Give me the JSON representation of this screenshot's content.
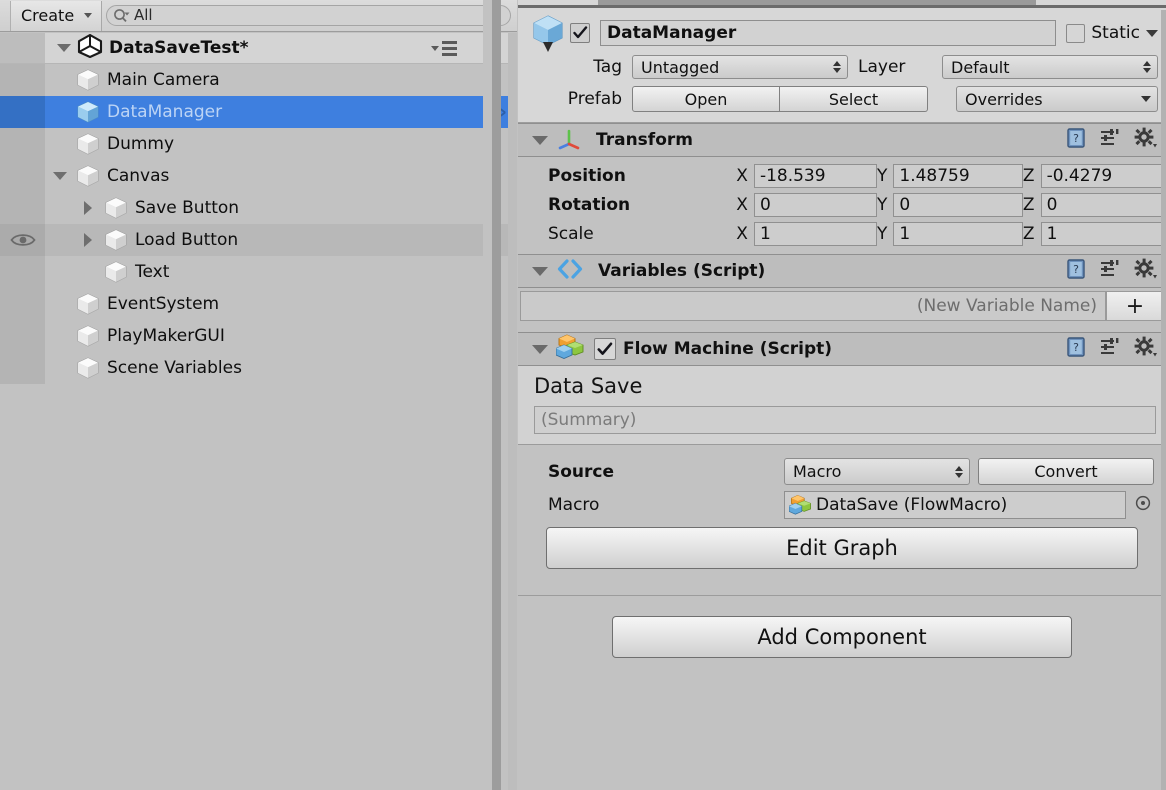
{
  "hierarchy": {
    "toolbar": {
      "create_label": "Create",
      "create_icon": "chevron-down-icon",
      "search_icon": "search-icon",
      "search_value": "All",
      "search_placeholder": "All"
    },
    "scene": {
      "label": "DataSaveTest*",
      "icon": "unity-logo-icon",
      "expanded": true,
      "options_icon": "hamburger-menu-icon"
    },
    "items": [
      {
        "label": "Main Camera",
        "icon": "gameobject-cube-icon",
        "depth": 1,
        "twisty": "none",
        "selected": false,
        "alt": false,
        "eye": false,
        "chevron": false
      },
      {
        "label": "DataManager",
        "icon": "prefab-cube-icon",
        "depth": 1,
        "twisty": "none",
        "selected": true,
        "alt": false,
        "eye": false,
        "chevron": true
      },
      {
        "label": "Dummy",
        "icon": "gameobject-cube-icon",
        "depth": 1,
        "twisty": "none",
        "selected": false,
        "alt": false,
        "eye": false,
        "chevron": false
      },
      {
        "label": "Canvas",
        "icon": "gameobject-cube-icon",
        "depth": 1,
        "twisty": "down",
        "selected": false,
        "alt": false,
        "eye": false,
        "chevron": false
      },
      {
        "label": "Save Button",
        "icon": "gameobject-cube-icon",
        "depth": 2,
        "twisty": "right",
        "selected": false,
        "alt": false,
        "eye": false,
        "chevron": false
      },
      {
        "label": "Load Button",
        "icon": "gameobject-cube-icon",
        "depth": 2,
        "twisty": "right",
        "selected": false,
        "alt": true,
        "eye": true,
        "chevron": false
      },
      {
        "label": "Text",
        "icon": "gameobject-cube-icon",
        "depth": 2,
        "twisty": "none",
        "selected": false,
        "alt": false,
        "eye": false,
        "chevron": false
      },
      {
        "label": "EventSystem",
        "icon": "gameobject-cube-icon",
        "depth": 1,
        "twisty": "none",
        "selected": false,
        "alt": false,
        "eye": false,
        "chevron": false
      },
      {
        "label": "PlayMakerGUI",
        "icon": "gameobject-cube-icon",
        "depth": 1,
        "twisty": "none",
        "selected": false,
        "alt": false,
        "eye": false,
        "chevron": false
      },
      {
        "label": "Scene Variables",
        "icon": "gameobject-cube-icon",
        "depth": 1,
        "twisty": "none",
        "selected": false,
        "alt": false,
        "eye": false,
        "chevron": false
      }
    ]
  },
  "inspector": {
    "gameobject": {
      "icon": "prefab-cube-icon",
      "enabled": true,
      "name": "DataManager",
      "static_label": "Static",
      "static_checked": false,
      "static_dropdown_icon": "chevron-down-icon",
      "tag_label": "Tag",
      "tag_value": "Untagged",
      "layer_label": "Layer",
      "layer_value": "Default",
      "prefab_label": "Prefab",
      "open_label": "Open",
      "select_label": "Select",
      "overrides_label": "Overrides"
    },
    "transform": {
      "title": "Transform",
      "icon": "transform-axis-icon",
      "expanded": true,
      "help_icon": "help-book-icon",
      "preset_icon": "preset-sliders-icon",
      "gear_icon": "gear-icon",
      "rows": [
        {
          "label": "Position",
          "bold": true,
          "x": "-18.539",
          "y": "1.48759",
          "z": "-0.4279"
        },
        {
          "label": "Rotation",
          "bold": true,
          "x": "0",
          "y": "0",
          "z": "0"
        },
        {
          "label": "Scale",
          "bold": false,
          "x": "1",
          "y": "1",
          "z": "1"
        }
      ],
      "axis_x": "X",
      "axis_y": "Y",
      "axis_z": "Z"
    },
    "variables": {
      "title": "Variables (Script)",
      "icon": "code-brackets-icon",
      "expanded": true,
      "help_icon": "help-book-icon",
      "preset_icon": "preset-sliders-icon",
      "gear_icon": "gear-icon",
      "new_variable_placeholder": "(New Variable Name)",
      "add_label": "+"
    },
    "flow_machine": {
      "title": "Flow Machine (Script)",
      "icon": "macro-blocks-icon",
      "expanded": true,
      "enabled": true,
      "help_icon": "help-book-icon",
      "preset_icon": "preset-sliders-icon",
      "gear_icon": "gear-icon",
      "graph_title": "Data Save",
      "summary_placeholder": "(Summary)",
      "source_label": "Source",
      "source_value": "Macro",
      "convert_label": "Convert",
      "macro_label": "Macro",
      "macro_value": "DataSave (FlowMacro)",
      "macro_icon": "macro-blocks-icon",
      "macro_picker_icon": "object-picker-icon",
      "edit_graph_label": "Edit Graph"
    },
    "add_component_label": "Add Component"
  },
  "colors": {
    "panel_bg": "#c2c2c2",
    "header_bg": "#d7d7d7",
    "selection_blue": "#3e7fdf",
    "selection_text": "#bcd4f5",
    "divider": "#8f8f8f"
  }
}
